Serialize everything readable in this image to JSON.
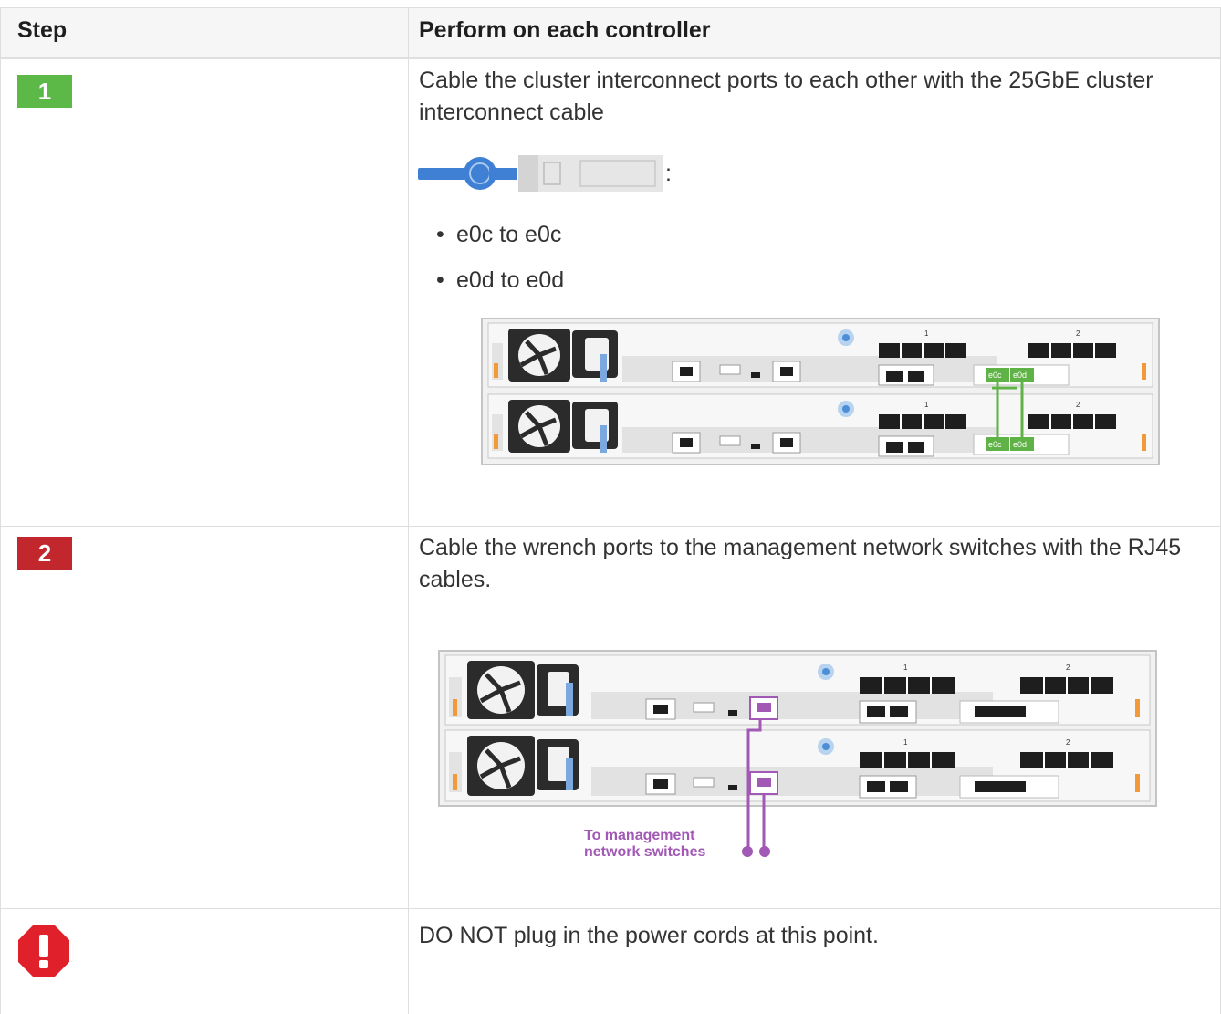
{
  "table": {
    "headers": {
      "step": "Step",
      "action": "Perform on each controller"
    },
    "rows": [
      {
        "step_number": "1",
        "step_color": "#5cb947",
        "instruction": "Cable the cluster interconnect ports to each other with the 25GbE cluster interconnect cable",
        "cable_suffix": ":",
        "bullets": [
          "e0c to e0c",
          "e0d to e0d"
        ],
        "diagram": {
          "slot_labels": [
            "1",
            "2"
          ],
          "port_labels": [
            "e0c",
            "e0d"
          ],
          "cable_color": "#5fb346"
        }
      },
      {
        "step_number": "2",
        "step_color": "#c1272d",
        "instruction": "Cable the wrench ports to the management network switches with the RJ45 cables.",
        "diagram": {
          "slot_labels": [
            "1",
            "2"
          ],
          "callout_line1": "To management",
          "callout_line2": "network switches",
          "cable_color": "#a259b5"
        }
      },
      {
        "icon": "warning-octagon-icon",
        "icon_color": "#e0202a",
        "instruction": "DO NOT plug in the power cords at this point."
      }
    ]
  }
}
